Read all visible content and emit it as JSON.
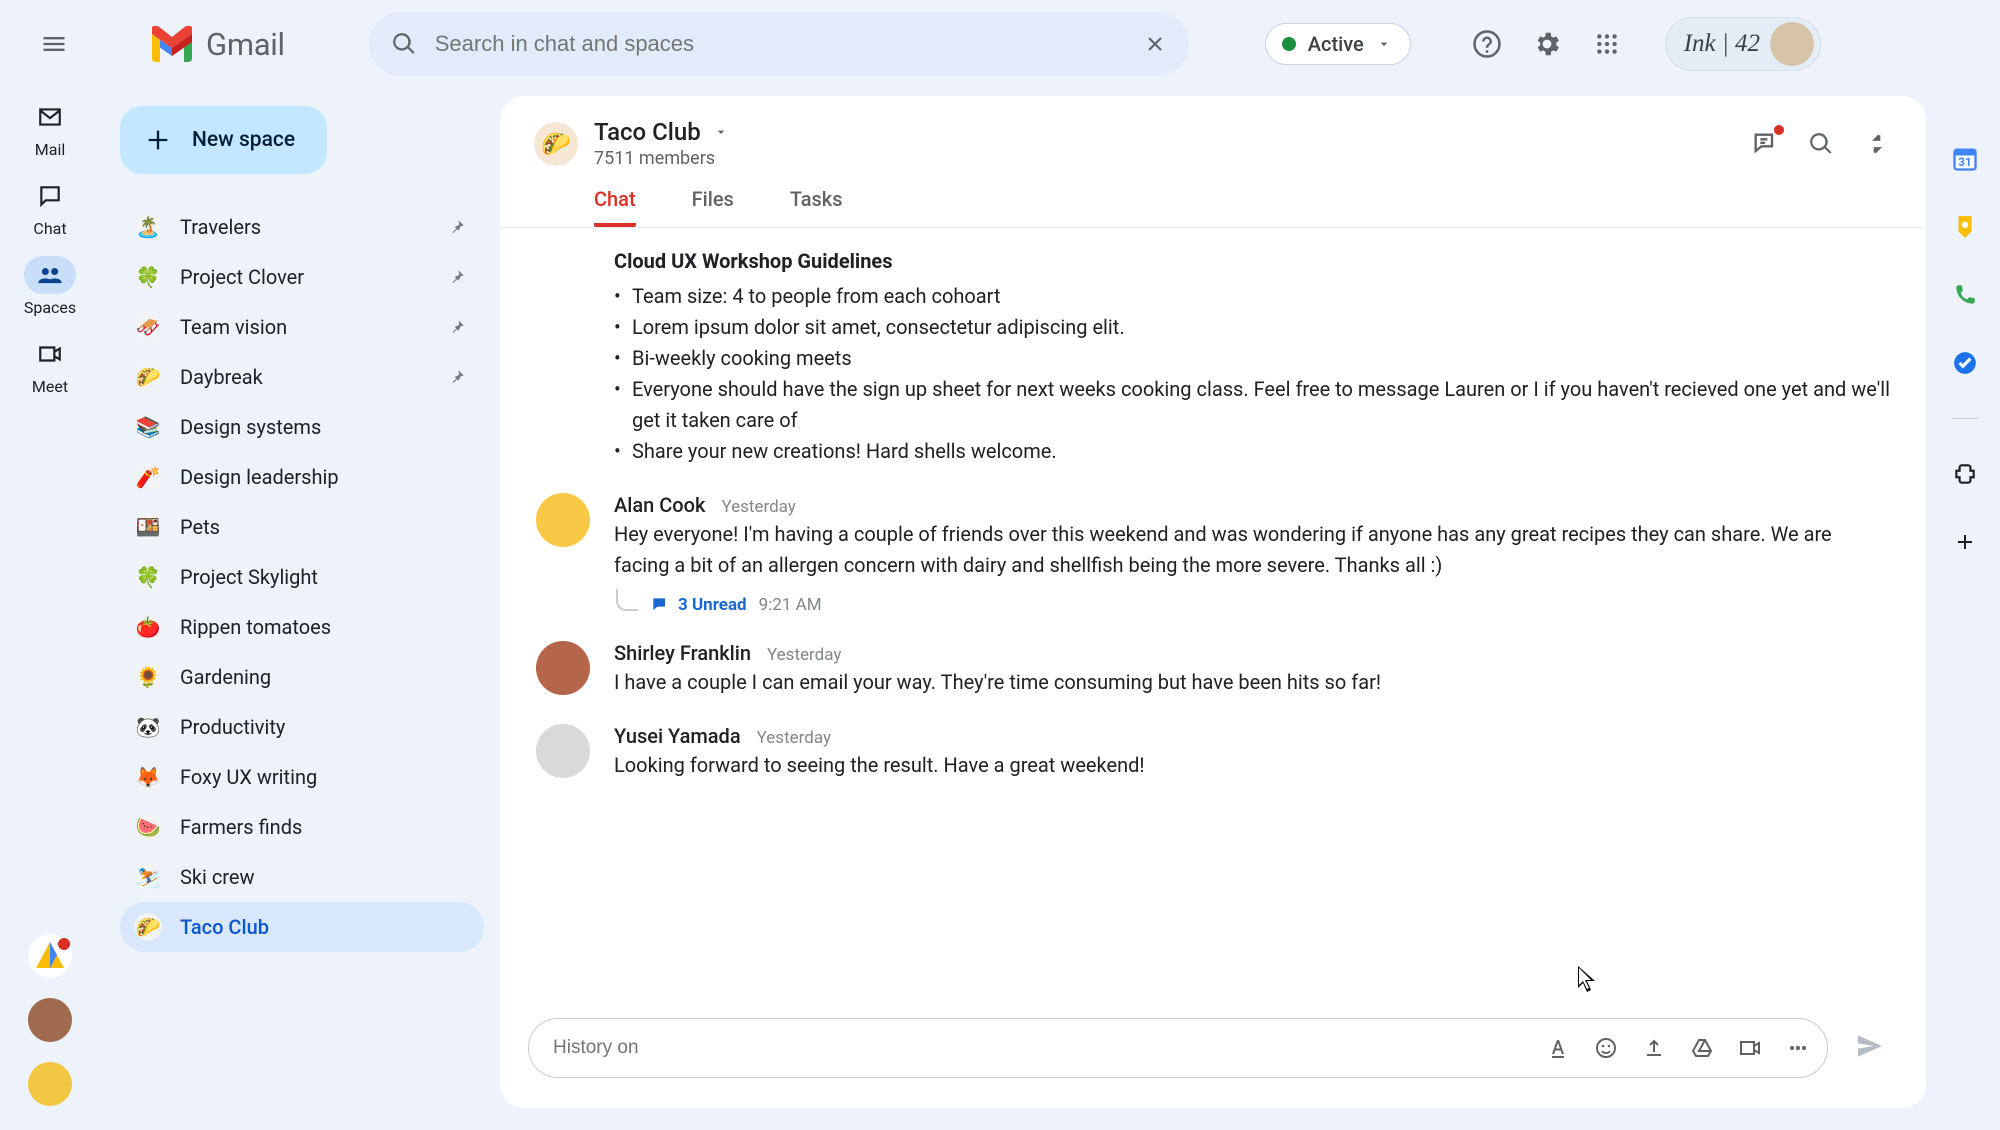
{
  "header": {
    "app_name": "Gmail",
    "search_placeholder": "Search in chat and spaces",
    "status_label": "Active",
    "profile_text": "Ink | 42"
  },
  "rail": {
    "items": [
      {
        "label": "Mail"
      },
      {
        "label": "Chat"
      },
      {
        "label": "Spaces"
      },
      {
        "label": "Meet"
      }
    ]
  },
  "sidebar": {
    "new_space_label": "New space",
    "spaces": [
      {
        "icon": "🏝️",
        "label": "Travelers",
        "pinned": true
      },
      {
        "icon": "🍀",
        "label": "Project Clover",
        "pinned": true
      },
      {
        "icon": "🛷",
        "label": "Team vision",
        "pinned": true
      },
      {
        "icon": "🌮",
        "label": "Daybreak",
        "pinned": true
      },
      {
        "icon": "📚",
        "label": "Design systems",
        "pinned": false
      },
      {
        "icon": "🧨",
        "label": "Design leadership",
        "pinned": false
      },
      {
        "icon": "🍱",
        "label": "Pets",
        "pinned": false
      },
      {
        "icon": "🍀",
        "label": "Project Skylight",
        "pinned": false
      },
      {
        "icon": "🍅",
        "label": "Rippen tomatoes",
        "pinned": false
      },
      {
        "icon": "🌻",
        "label": "Gardening",
        "pinned": false
      },
      {
        "icon": "🐼",
        "label": "Productivity",
        "pinned": false
      },
      {
        "icon": "🦊",
        "label": "Foxy UX writing",
        "pinned": false
      },
      {
        "icon": "🍉",
        "label": "Farmers finds",
        "pinned": false
      },
      {
        "icon": "⛷️",
        "label": "Ski crew",
        "pinned": false
      },
      {
        "icon": "🌮",
        "label": "Taco Club",
        "pinned": false,
        "selected": true
      }
    ]
  },
  "panel": {
    "space_icon": "🌮",
    "space_name": "Taco Club",
    "members_text": "7511 members",
    "tabs": {
      "chat": "Chat",
      "files": "Files",
      "tasks": "Tasks"
    }
  },
  "messages": {
    "guidelines": {
      "subject": "Cloud UX Workshop Guidelines",
      "bullets": [
        "Team size: 4 to people from each cohoart",
        "Lorem ipsum dolor sit amet, consectetur adipiscing elit.",
        "Bi-weekly cooking meets",
        "Everyone should have the sign up sheet for next weeks cooking class. Feel free to message Lauren or I if you haven't recieved one yet and we'll get it taken care of",
        "Share your new creations! Hard shells welcome."
      ]
    },
    "m1": {
      "author": "Alan Cook",
      "ts": "Yesterday",
      "text": "Hey everyone! I'm having a couple of friends over this weekend and was wondering if anyone has any great recipes they can share. We are facing a bit of an allergen concern with dairy and shellfish being the more severe. Thanks all :)",
      "unread_label": "3 Unread",
      "unread_ts": "9:21 AM"
    },
    "m2": {
      "author": "Shirley Franklin",
      "ts": "Yesterday",
      "text": "I have a couple I can email your way. They're time consuming but have been hits so far!"
    },
    "m3": {
      "author": "Yusei Yamada",
      "ts": "Yesterday",
      "text": "Looking forward to seeing the result. Have a great weekend!"
    }
  },
  "composer": {
    "placeholder": "History on"
  }
}
